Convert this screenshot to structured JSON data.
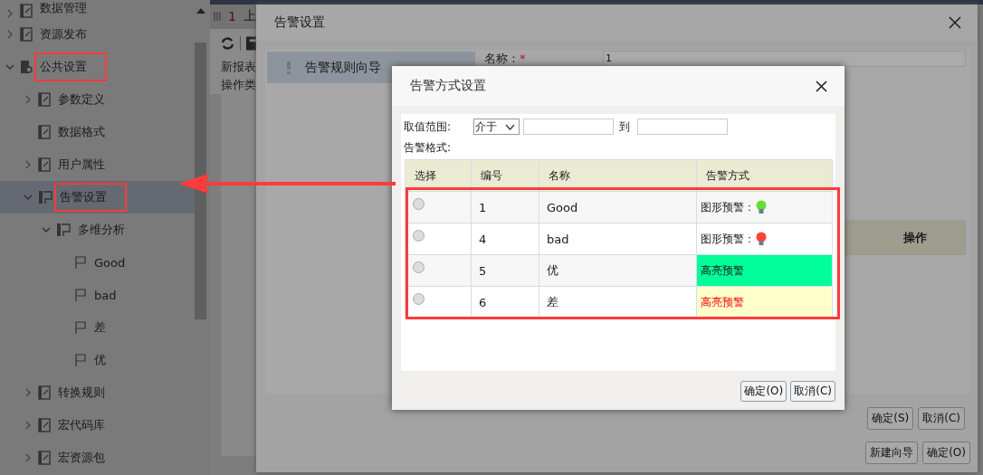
{
  "tree": [
    {
      "label": "数据管理",
      "expandable": true,
      "expanded": false,
      "selected": false,
      "annotated": false,
      "kind": "doc"
    },
    {
      "label": "资源发布",
      "expandable": true,
      "expanded": false,
      "selected": false,
      "annotated": false,
      "kind": "doc"
    },
    {
      "label": "公共设置",
      "expandable": true,
      "expanded": true,
      "selected": false,
      "annotated": true,
      "kind": "gear",
      "children": [
        {
          "label": "参数定义",
          "expandable": true,
          "expanded": false,
          "selected": false,
          "annotated": false,
          "kind": "doc"
        },
        {
          "label": "数据格式",
          "expandable": false,
          "selected": false,
          "annotated": false,
          "kind": "doc"
        },
        {
          "label": "用户属性",
          "expandable": true,
          "expanded": false,
          "selected": false,
          "annotated": false,
          "kind": "doc"
        },
        {
          "label": "告警设置",
          "expandable": true,
          "expanded": true,
          "selected": true,
          "annotated": true,
          "kind": "flagdoc",
          "children": [
            {
              "label": "多维分析",
              "expandable": true,
              "expanded": true,
              "selected": false,
              "annotated": false,
              "kind": "flagdoc",
              "children": [
                {
                  "label": "Good",
                  "expandable": false,
                  "selected": false,
                  "annotated": false,
                  "kind": "flag"
                },
                {
                  "label": "bad",
                  "expandable": false,
                  "selected": false,
                  "annotated": false,
                  "kind": "flag"
                },
                {
                  "label": "差",
                  "expandable": false,
                  "selected": false,
                  "annotated": false,
                  "kind": "flag"
                },
                {
                  "label": "优",
                  "expandable": false,
                  "selected": false,
                  "annotated": false,
                  "kind": "flag"
                }
              ]
            }
          ]
        },
        {
          "label": "转换规则",
          "expandable": true,
          "expanded": false,
          "selected": false,
          "annotated": false,
          "kind": "doc"
        },
        {
          "label": "宏代码库",
          "expandable": true,
          "expanded": false,
          "selected": false,
          "annotated": false,
          "kind": "doc"
        },
        {
          "label": "宏资源包",
          "expandable": true,
          "expanded": false,
          "selected": false,
          "annotated": false,
          "kind": "doc"
        }
      ]
    }
  ],
  "middle": {
    "tab_number": "1",
    "tab_label": "上",
    "lines": [
      "新报表",
      "操作类"
    ]
  },
  "outer_dialog": {
    "title": "告警设置",
    "nav": [
      {
        "label": "告警规则向导",
        "selected": true
      }
    ],
    "name_label": "名称：",
    "required_mark": "*",
    "name_value": "1",
    "table_columns": [
      "操作"
    ],
    "buttons_row_1": [
      "确定(S)",
      "取消(C)"
    ],
    "buttons_row_2": [
      "新建向导",
      "确定(O)"
    ]
  },
  "dialog": {
    "title": "告警方式设置",
    "range_label": "取值范围:",
    "range_operator": "介于",
    "range_to": "到",
    "format_label": "告警格式:",
    "columns": [
      "选择",
      "编号",
      "名称",
      "告警方式"
    ],
    "annotated": true,
    "rows": [
      {
        "selected": false,
        "number": "1",
        "name": "Good",
        "kind": "bulb",
        "style_label": "图形预警：",
        "color": "#66dd33"
      },
      {
        "selected": false,
        "number": "4",
        "name": "bad",
        "kind": "bulb",
        "style_label": "图形预警：",
        "color": "#ff4433"
      },
      {
        "selected": false,
        "number": "5",
        "name": "优",
        "kind": "highlight",
        "style_label": "高亮预警",
        "color": "#00ff99"
      },
      {
        "selected": false,
        "number": "6",
        "name": "差",
        "kind": "warning",
        "style_label": "高亮预警",
        "color": "#ffffcc"
      }
    ],
    "buttons": [
      "确定(O)",
      "取消(C)"
    ]
  }
}
